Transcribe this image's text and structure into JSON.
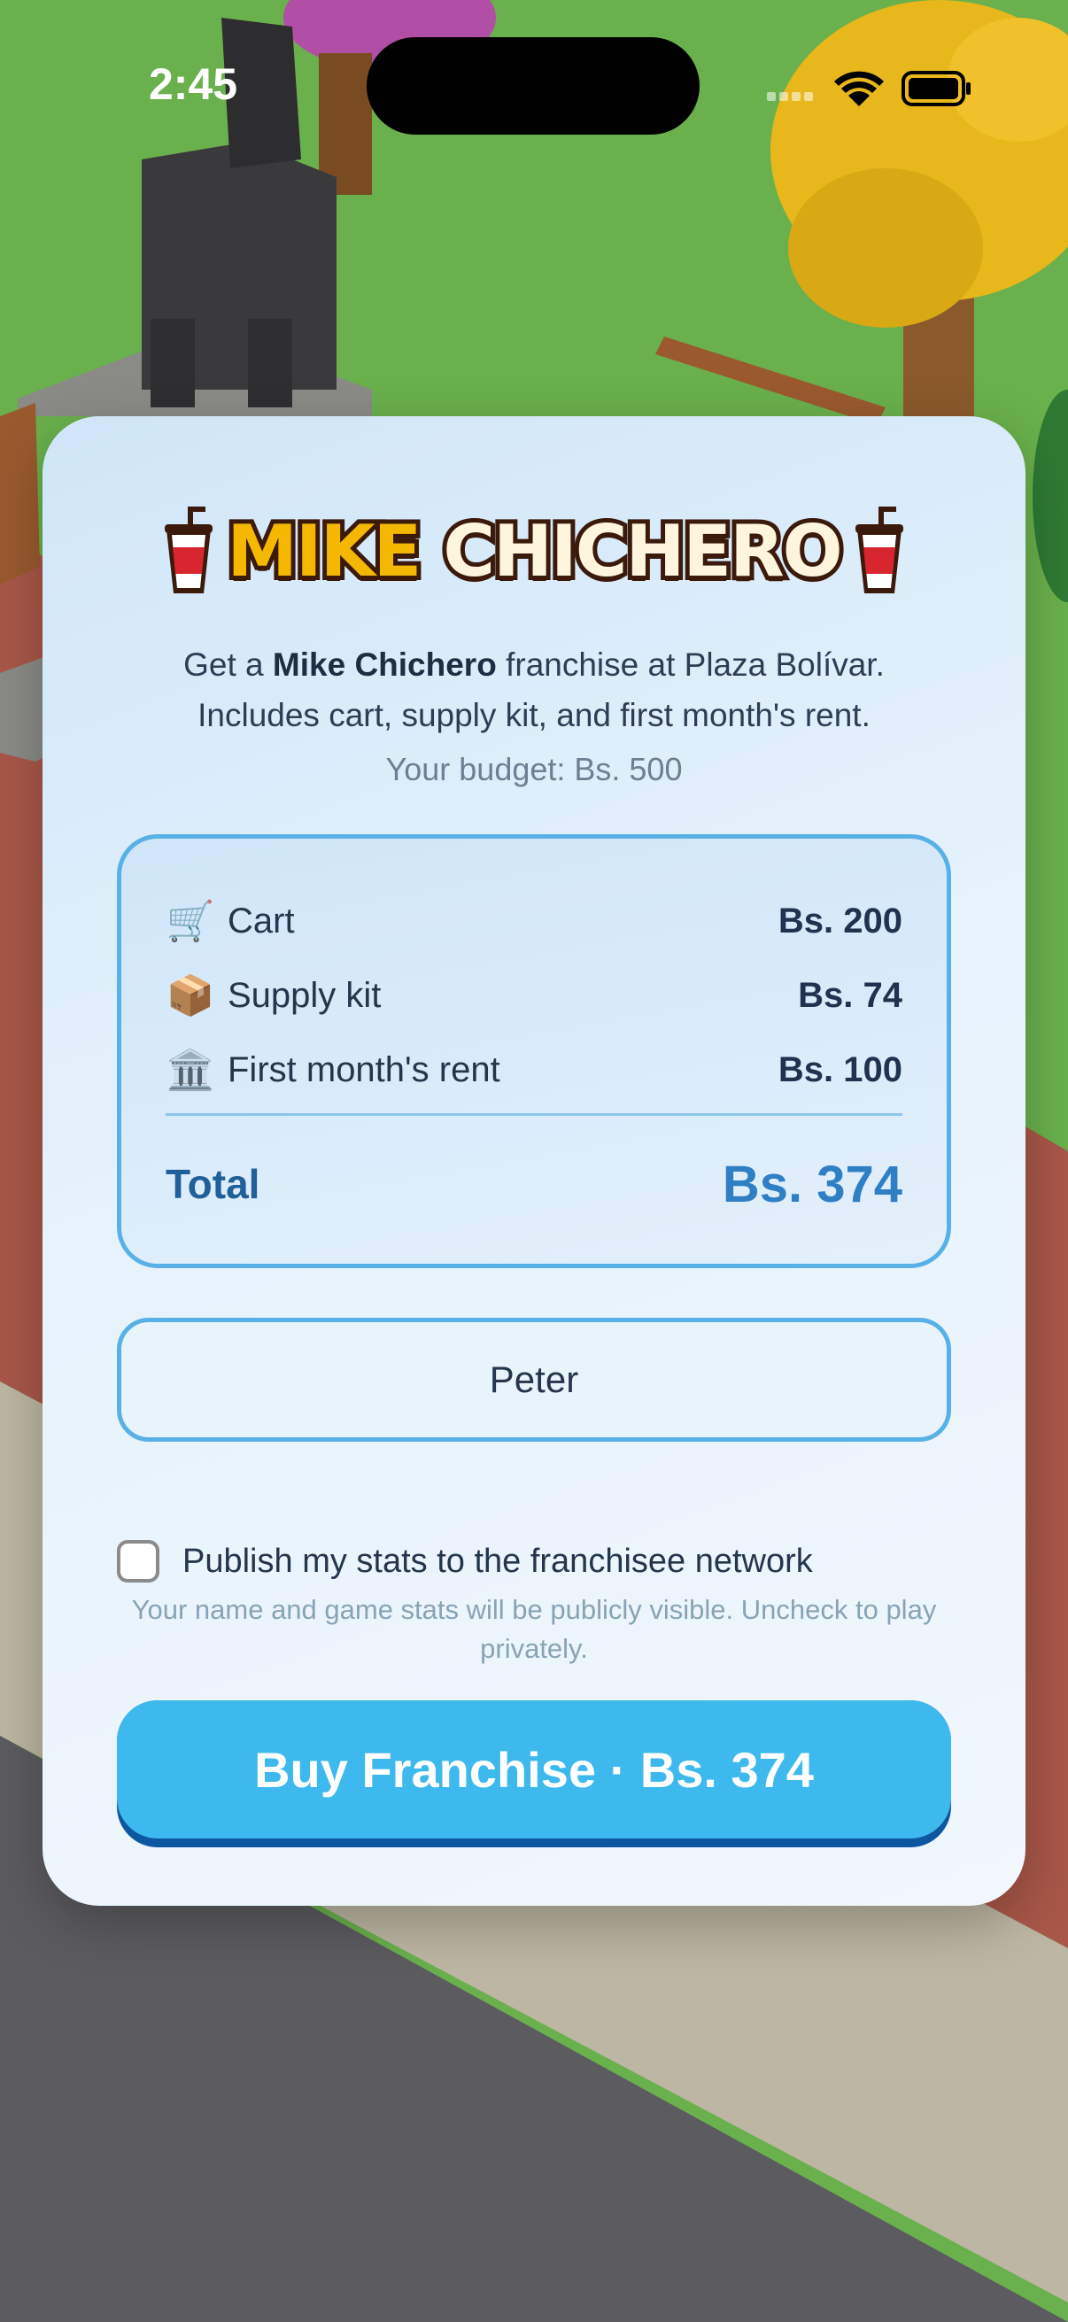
{
  "status_bar": {
    "time": "2:45",
    "icons": [
      "cellular-icon",
      "wifi-icon",
      "battery-icon"
    ]
  },
  "modal": {
    "logo": {
      "word1": "MIKE",
      "word2": "CHICHERO",
      "icon": "soda-cup-icon"
    },
    "description": {
      "prefix": "Get a ",
      "brand": "Mike Chichero",
      "suffix": " franchise at Plaza Bolívar.",
      "line2": "Includes cart, supply kit, and first month's rent."
    },
    "budget": "Your budget: Bs. 500",
    "costs": [
      {
        "icon": "🛒",
        "label": "Cart",
        "amount": "Bs. 200"
      },
      {
        "icon": "📦",
        "label": "Supply kit",
        "amount": "Bs. 74"
      },
      {
        "icon": "🏛️",
        "label": "First month's rent",
        "amount": "Bs. 100"
      }
    ],
    "total": {
      "label": "Total",
      "amount": "Bs. 374"
    },
    "name_input": {
      "value": "Peter"
    },
    "publish": {
      "checked": false,
      "label": "Publish my stats to the franchisee network",
      "note": "Your name and game stats will be publicly visible. Uncheck to play privately."
    },
    "buy_button": "Buy Franchise · Bs. 374"
  },
  "colors": {
    "accent": "#3db9ee",
    "accent_dark": "#0d57a0",
    "total": "#2e7fc4",
    "border": "#58b1e6"
  }
}
